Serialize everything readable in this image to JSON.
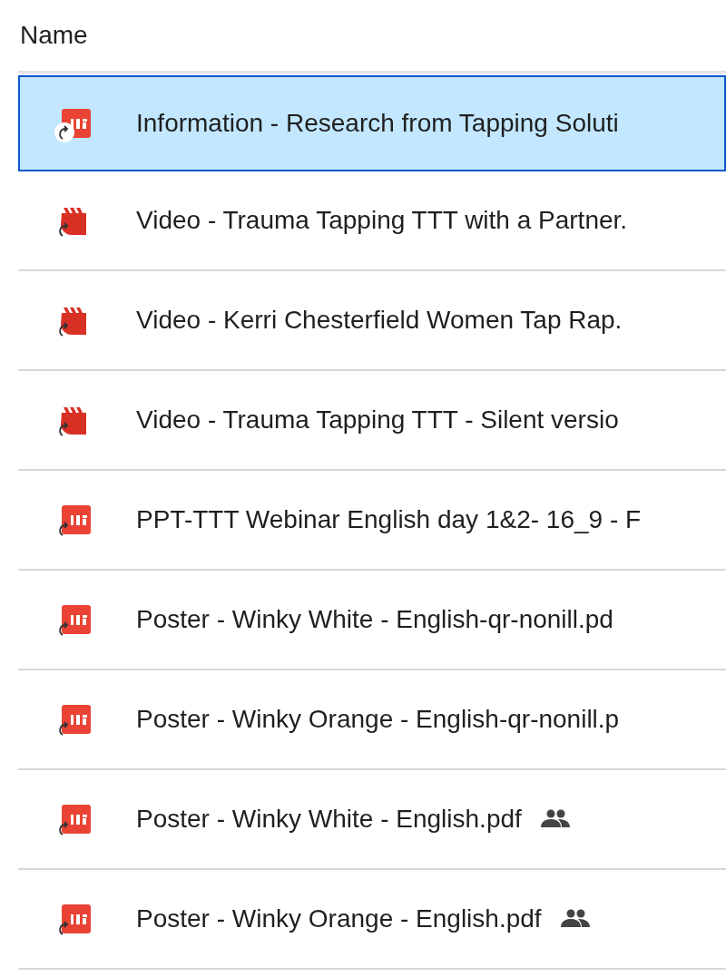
{
  "header": {
    "column_name": "Name"
  },
  "files": [
    {
      "name": "Information - Research from Tapping Soluti",
      "kind": "pdf",
      "shortcut": true,
      "shared": false,
      "selected": true
    },
    {
      "name": "Video - Trauma Tapping TTT with a Partner.",
      "kind": "video",
      "shortcut": true,
      "shared": false,
      "selected": false
    },
    {
      "name": "Video - Kerri Chesterfield Women Tap Rap.",
      "kind": "video",
      "shortcut": true,
      "shared": false,
      "selected": false
    },
    {
      "name": "Video - Trauma Tapping TTT - Silent versio",
      "kind": "video",
      "shortcut": true,
      "shared": false,
      "selected": false
    },
    {
      "name": "PPT-TTT Webinar English day 1&2- 16_9 - F",
      "kind": "pdf",
      "shortcut": true,
      "shared": false,
      "selected": false
    },
    {
      "name": "Poster - Winky White - English-qr-nonill.pd",
      "kind": "pdf",
      "shortcut": true,
      "shared": false,
      "selected": false
    },
    {
      "name": "Poster - Winky Orange - English-qr-nonill.p",
      "kind": "pdf",
      "shortcut": true,
      "shared": false,
      "selected": false
    },
    {
      "name": "Poster - Winky White - English.pdf",
      "kind": "pdf",
      "shortcut": true,
      "shared": true,
      "selected": false
    },
    {
      "name": "Poster - Winky Orange - English.pdf",
      "kind": "pdf",
      "shortcut": true,
      "shared": true,
      "selected": false
    }
  ]
}
